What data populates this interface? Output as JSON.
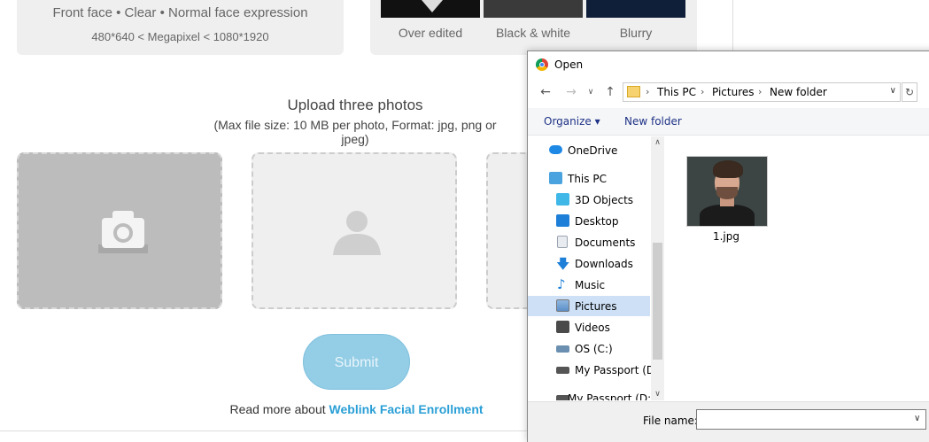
{
  "requirements": {
    "line1": "Front face • Clear • Normal face expression",
    "line2": "480*640 < Megapixel < 1080*1920"
  },
  "examples": [
    {
      "label": "Over edited"
    },
    {
      "label": "Black & white"
    },
    {
      "label": "Blurry"
    }
  ],
  "upload": {
    "title": "Upload three photos",
    "subtitle": "(Max file size: 10 MB per photo, Format: jpg, png or jpeg)"
  },
  "submit_label": "Submit",
  "read_more": {
    "prefix": "Read more about ",
    "link": "Weblink Facial Enrollment"
  },
  "dialog": {
    "title": "Open",
    "breadcrumb": [
      "This PC",
      "Pictures",
      "New folder"
    ],
    "toolbar": {
      "organize": "Organize",
      "new_folder": "New folder"
    },
    "nav_items": [
      {
        "label": "OneDrive",
        "icon": "onedrive-icon",
        "color": "#1e88e5"
      },
      {
        "label": "This PC",
        "icon": "computer-icon",
        "color": "#4aa3df"
      },
      {
        "label": "3D Objects",
        "icon": "cube-icon",
        "color": "#3fb8e8"
      },
      {
        "label": "Desktop",
        "icon": "desktop-icon",
        "color": "#1e7fd8"
      },
      {
        "label": "Documents",
        "icon": "document-icon",
        "color": "#9aa4b0"
      },
      {
        "label": "Downloads",
        "icon": "download-icon",
        "color": "#1e7fd8"
      },
      {
        "label": "Music",
        "icon": "music-icon",
        "color": "#1e7fd8"
      },
      {
        "label": "Pictures",
        "icon": "pictures-icon",
        "color": "#5b8fc8",
        "selected": true
      },
      {
        "label": "Videos",
        "icon": "video-icon",
        "color": "#4a4a4a"
      },
      {
        "label": "OS (C:)",
        "icon": "drive-icon",
        "color": "#6a8fb0"
      },
      {
        "label": "My Passport (D:)",
        "icon": "drive-icon",
        "color": "#555"
      },
      {
        "label": "My Passport (D:)",
        "icon": "drive-icon",
        "color": "#555"
      }
    ],
    "files": [
      {
        "name": "1.jpg"
      }
    ],
    "file_name_label": "File name:",
    "file_name_value": ""
  }
}
